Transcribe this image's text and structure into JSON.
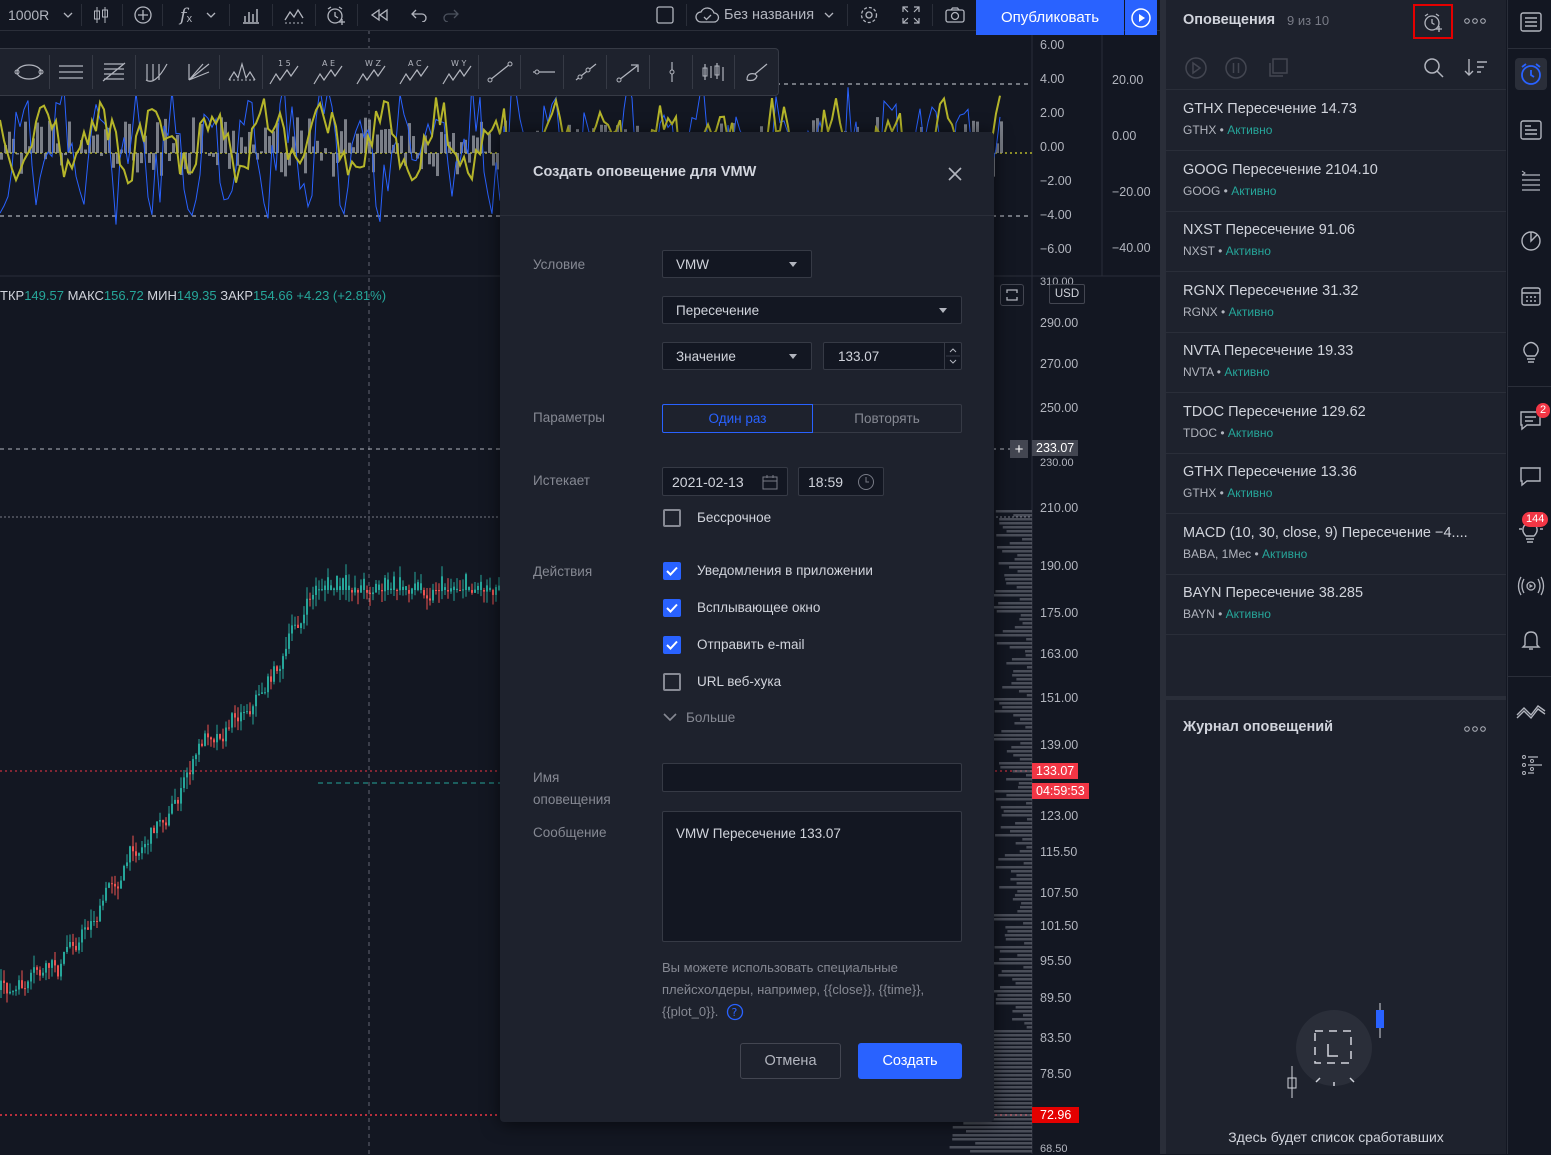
{
  "topbar": {
    "interval": "1000R",
    "chart_name": "Без названия",
    "publish_label": "Опубликовать"
  },
  "drawing_tools": [
    "ellipse-tool",
    "channel-tool",
    "fib-tool",
    "pitchfork-tool",
    "gann-tool",
    "head-shoulders-tool",
    "elliott-impulse-tool",
    "abcde-tool",
    "wxyz-tool",
    "abcd-tool",
    "wxy-tool",
    "line-tool",
    "horizontal-ray-tool",
    "ray-tool",
    "arrow-tool",
    "vertical-line-tool",
    "bars-pattern-tool",
    "brush-tool"
  ],
  "pattern_labels": {
    "p1": "1 5",
    "p2": "A E",
    "p3": "W Z",
    "p4": "A C",
    "p5": "W Y"
  },
  "indicator_axis": {
    "left_ticks": [
      "6.00",
      "4.00",
      "2.00",
      "0.00",
      "−2.00",
      "−4.00",
      "−6.00"
    ],
    "right_ticks": [
      "20.00",
      "0.00",
      "−20.00",
      "−40.00"
    ]
  },
  "ohlc": {
    "open_label": "ТКР",
    "open": "149.57",
    "high_label": "МАКС",
    "high": "156.72",
    "low_label": "МИН",
    "low": "149.35",
    "close_label": "ЗАКР",
    "close": "154.66",
    "change": "+4.23 (+2.81%)"
  },
  "price_axis": {
    "currency": "USD",
    "top_partial": "310.00",
    "ticks": [
      "290.00",
      "270.00",
      "250.00",
      "210.00",
      "190.00",
      "175.00",
      "163.00",
      "151.00",
      "139.00",
      "123.00",
      "115.50",
      "107.50",
      "101.50",
      "95.50",
      "89.50",
      "83.50",
      "78.50",
      "68.50"
    ],
    "alert_level": "233.07",
    "alert_level_partial": "230.00",
    "current_price": "133.07",
    "countdown": "04:59:53",
    "low_marker": "72.96"
  },
  "dialog": {
    "title": "Создать оповещение для VMW",
    "condition_label": "Условие",
    "symbol": "VMW",
    "condition_type": "Пересечение",
    "value_type": "Значение",
    "value": "133.07",
    "params_label": "Параметры",
    "once_label": "Один раз",
    "repeat_label": "Повторять",
    "expires_label": "Истекает",
    "expire_date": "2021-02-13",
    "expire_time": "18:59",
    "open_ended_label": "Бессрочное",
    "actions_label": "Действия",
    "action_app": "Уведомления в приложении",
    "action_popup": "Всплывающее окно",
    "action_email": "Отправить e-mail",
    "action_webhook": "URL веб-хука",
    "more_label": "Больше",
    "name_label_1": "Имя",
    "name_label_2": "оповещения",
    "name_value": "",
    "message_label": "Сообщение",
    "message_value": "VMW Пересечение 133.07",
    "hint_1": "Вы можете использовать специальные",
    "hint_2": "плейсхолдеры, например, {{close}}, {{time}},",
    "hint_3": "{{plot_0}}.",
    "cancel_label": "Отмена",
    "create_label": "Создать"
  },
  "alerts_panel": {
    "title": "Оповещения",
    "count": "9 из 10",
    "items": [
      {
        "title": "GTHX Пересечение 14.73",
        "symbol": "GTHX",
        "status": "Активно"
      },
      {
        "title": "GOOG Пересечение 2104.10",
        "symbol": "GOOG",
        "status": "Активно"
      },
      {
        "title": "NXST Пересечение 91.06",
        "symbol": "NXST",
        "status": "Активно"
      },
      {
        "title": "RGNX Пересечение 31.32",
        "symbol": "RGNX",
        "status": "Активно"
      },
      {
        "title": "NVTA Пересечение 19.33",
        "symbol": "NVTA",
        "status": "Активно"
      },
      {
        "title": "TDOC Пересечение 129.62",
        "symbol": "TDOC",
        "status": "Активно"
      },
      {
        "title": "GTHX Пересечение 13.36",
        "symbol": "GTHX",
        "status": "Активно"
      },
      {
        "title": "MACD (10, 30, close, 9) Пересечение −4....",
        "symbol": "BABA, 1Мес",
        "status": "Активно"
      },
      {
        "title": "BAYN Пересечение 38.285",
        "symbol": "BAYN",
        "status": "Активно"
      }
    ],
    "log_title": "Журнал оповещений",
    "log_empty": "Здесь будет список сработавших"
  },
  "sidebar": {
    "chat_badge": "2",
    "ideas_badge": "144"
  },
  "colors": {
    "accent": "#2962ff",
    "up": "#26a69a",
    "down": "#ef5350",
    "alert_line": "#f23645",
    "highlight": "#e40000"
  }
}
